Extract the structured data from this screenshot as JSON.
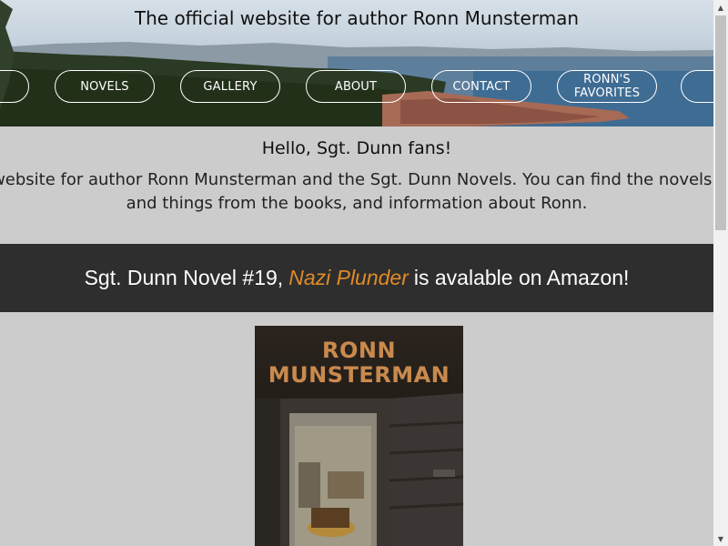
{
  "header": {
    "site_title": "The official website for author Ronn Munsterman",
    "nav": [
      {
        "label": ""
      },
      {
        "label": "NOVELS"
      },
      {
        "label": "GALLERY"
      },
      {
        "label": "ABOUT"
      },
      {
        "label": "CONTACT"
      },
      {
        "label": "RONN'S\nFAVORITES"
      },
      {
        "label": ""
      }
    ]
  },
  "intro": {
    "greeting": "Hello, Sgt. Dunn fans!",
    "text": "Welcome to the official website for author Ronn Munsterman and the Sgt. Dunn Novels. You can find the novels here, a gallery of places and things from the books, and information about Ronn."
  },
  "banner": {
    "prefix": "Sgt. Dunn Novel #19,",
    "book_title": "Nazi Plunder",
    "suffix": "is avalable on Amazon!"
  },
  "book": {
    "author_line1": "RONN",
    "author_line2": "MUNSTERMAN"
  },
  "colors": {
    "page_bg": "#cccccc",
    "banner_bg": "#2e2e2e",
    "accent": "#e08a28",
    "cover_text": "#c98a4e"
  },
  "icons": {
    "scroll_up": "triangle-up-icon",
    "scroll_down": "triangle-down-icon"
  }
}
